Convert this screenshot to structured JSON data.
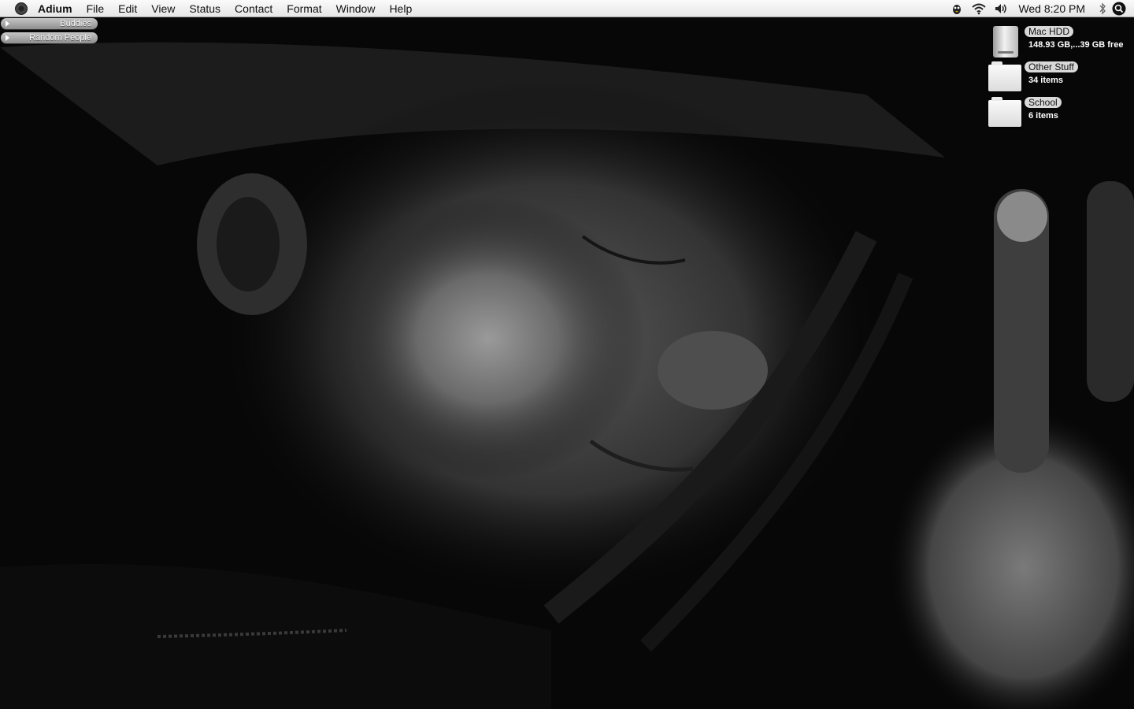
{
  "menubar": {
    "app_name": "Adium",
    "menus": [
      "File",
      "Edit",
      "View",
      "Status",
      "Contact",
      "Format",
      "Window",
      "Help"
    ],
    "clock": "Wed 8:20 PM",
    "status_icons": [
      "adium-duck-icon",
      "wifi-icon",
      "volume-icon",
      "bluetooth-icon"
    ],
    "spotlight_icon": "spotlight-search-icon"
  },
  "contact_list": {
    "groups": [
      {
        "label": "Buddies"
      },
      {
        "label": "Random People"
      }
    ]
  },
  "desktop": {
    "items": [
      {
        "name": "Mac HDD",
        "info": "148.93 GB,...39 GB free",
        "icon": "hard-drive-icon"
      },
      {
        "name": "Other Stuff",
        "info": "34 items",
        "icon": "folder-icon"
      },
      {
        "name": "School",
        "info": "6 items",
        "icon": "folder-icon"
      }
    ]
  },
  "wallpaper": {
    "description_icon": "wallpaper-image"
  }
}
